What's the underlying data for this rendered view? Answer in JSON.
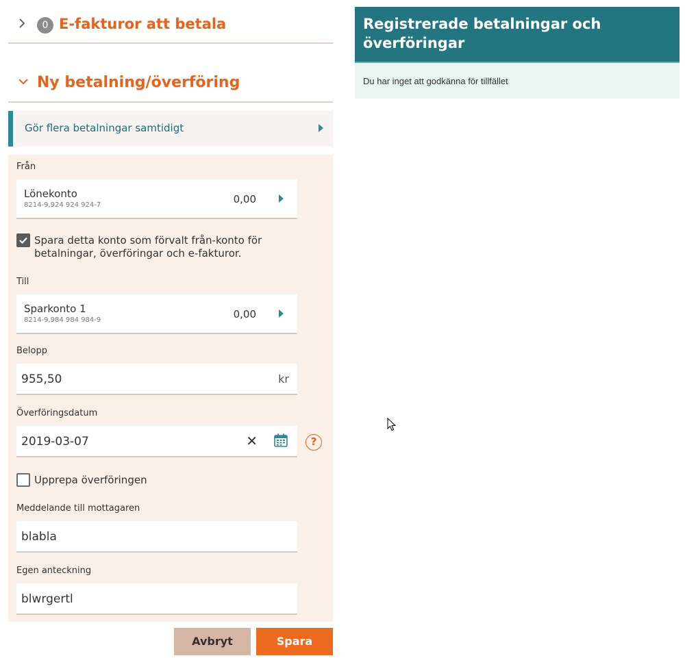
{
  "efakturor": {
    "count": "0",
    "title": "E-fakturor att betala"
  },
  "ny": {
    "title": "Ny betalning/överföring"
  },
  "multi": {
    "label": "Gör flera betalningar samtidigt"
  },
  "form": {
    "fran_label": "Från",
    "from_account": {
      "name": "Lönekonto",
      "number": "8214-9,924 924 924-7",
      "balance": "0,00"
    },
    "save_default_label": "Spara detta konto som förvalt från-konto för betalningar, överföringar och e-fakturor.",
    "save_default_checked": true,
    "till_label": "Till",
    "to_account": {
      "name": "Sparkonto 1",
      "number": "8214-9,984 984 984-9",
      "balance": "0,00"
    },
    "belopp_label": "Belopp",
    "belopp_value": "955,50",
    "belopp_unit": "kr",
    "datum_label": "Överföringsdatum",
    "datum_value": "2019-03-07",
    "repeat_label": "Upprepa överföringen",
    "repeat_checked": false,
    "meddelande_label": "Meddelande till mottagaren",
    "meddelande_value": "blabla",
    "anteckning_label": "Egen anteckning",
    "anteckning_value": "blwrgertl"
  },
  "buttons": {
    "cancel": "Avbryt",
    "save": "Spara"
  },
  "panel": {
    "title": "Registrerade betalningar och överföringar",
    "message": "Du har inget att godkänna för tillfället"
  },
  "colors": {
    "accent_orange": "#e8621a",
    "teal_header": "#23757f",
    "form_bg": "#faf0e7",
    "save_button": "#ec6b1f",
    "cancel_button": "#d5b6a4"
  }
}
